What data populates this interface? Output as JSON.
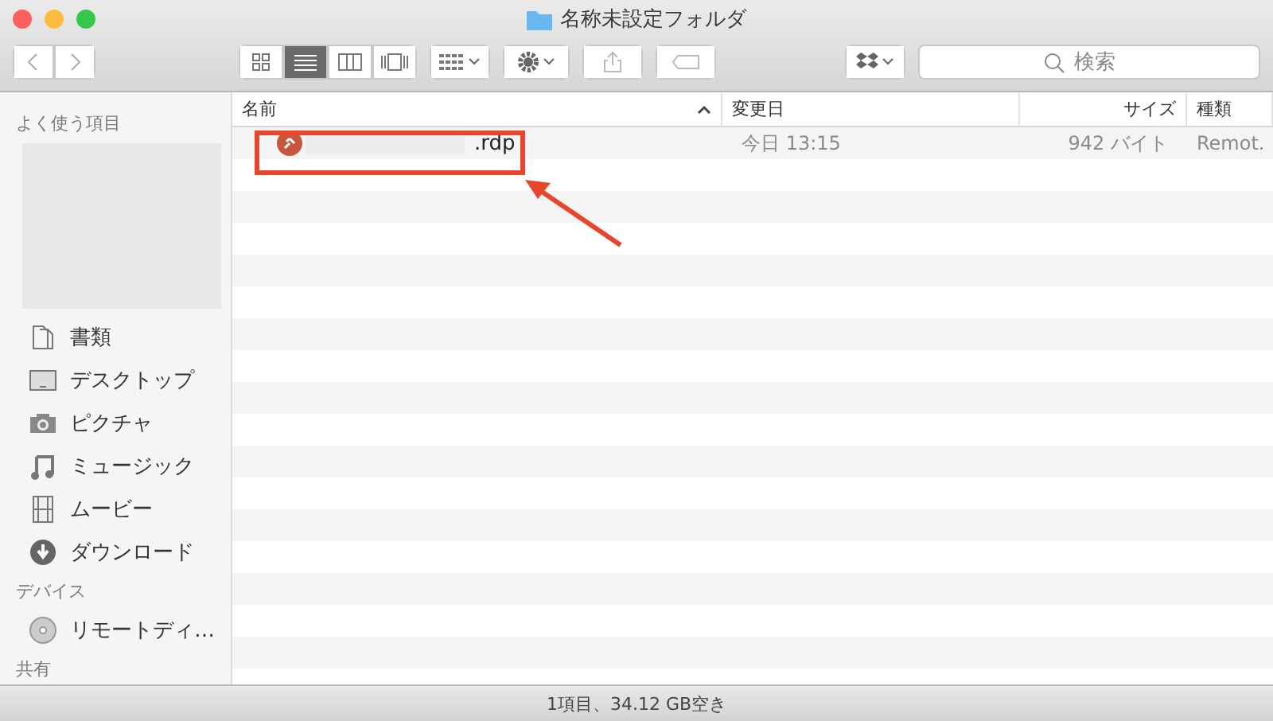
{
  "window": {
    "title": "名称未設定フォルダ"
  },
  "toolbar": {
    "view_modes": [
      {
        "kind": "icons",
        "selected": false
      },
      {
        "kind": "list",
        "selected": true
      },
      {
        "kind": "columns",
        "selected": false
      },
      {
        "kind": "coverflow",
        "selected": false
      }
    ],
    "search": {
      "placeholder": "検索"
    }
  },
  "sidebar": {
    "sections": [
      {
        "title": "よく使う項目",
        "redacted": true,
        "items": [
          {
            "label": "書類",
            "kind": "documents"
          },
          {
            "label": "デスクトップ",
            "kind": "desktop"
          },
          {
            "label": "ピクチャ",
            "kind": "pictures"
          },
          {
            "label": "ミュージック",
            "kind": "music"
          },
          {
            "label": "ムービー",
            "kind": "movies"
          },
          {
            "label": "ダウンロード",
            "kind": "downloads"
          }
        ]
      },
      {
        "title": "デバイス",
        "items": [
          {
            "label": "リモートディ…",
            "kind": "disc"
          }
        ]
      },
      {
        "title": "共有"
      }
    ]
  },
  "table": {
    "columns": [
      {
        "label": "名前",
        "sorted": true
      },
      {
        "label": "変更日",
        "sorted": false
      },
      {
        "label": "サイズ",
        "sorted": false
      },
      {
        "label": "種類",
        "sorted": false
      }
    ],
    "rows": [
      {
        "name": ".rdp",
        "name_redacted": true,
        "modified": "今日 13:15",
        "size": "942 バイト",
        "kind": "Remot.",
        "highlighted": true
      }
    ]
  },
  "status_bar": "1項目、34.12 GB空き"
}
